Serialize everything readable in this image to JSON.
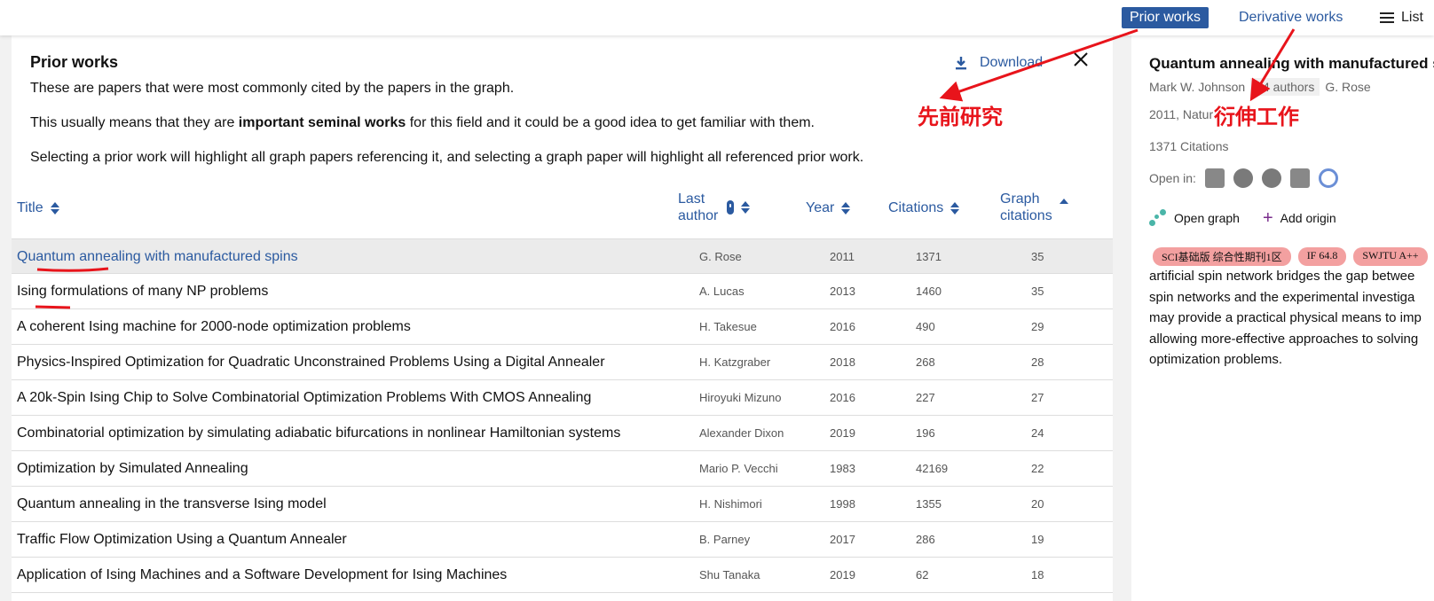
{
  "topbar": {
    "tabs": [
      {
        "label": "Prior works"
      },
      {
        "label": "Derivative works"
      },
      {
        "label": "List"
      }
    ]
  },
  "panel": {
    "title": "Prior works",
    "download_label": "Download",
    "intro_1": "These are papers that were most commonly cited by the papers in the graph.",
    "intro_2_pre": "This usually means that they are ",
    "intro_2_bold": "important seminal works",
    "intro_2_post": " for this field and it could be a good idea to get familiar with them.",
    "intro_3": "Selecting a prior work will highlight all graph papers referencing it, and selecting a graph paper will highlight all referenced prior work."
  },
  "table": {
    "headers": {
      "title": "Title",
      "last_author_1": "Last",
      "last_author_2": "author",
      "year": "Year",
      "citations": "Citations",
      "graph_citations_1": "Graph",
      "graph_citations_2": "citations"
    },
    "rows": [
      {
        "title": "Quantum annealing with manufactured spins",
        "author": "G. Rose",
        "year": "2011",
        "citations": "1371",
        "graph_citations": "35"
      },
      {
        "title": "Ising formulations of many NP problems",
        "author": "A. Lucas",
        "year": "2013",
        "citations": "1460",
        "graph_citations": "35"
      },
      {
        "title": "A coherent Ising machine for 2000-node optimization problems",
        "author": "H. Takesue",
        "year": "2016",
        "citations": "490",
        "graph_citations": "29"
      },
      {
        "title": "Physics-Inspired Optimization for Quadratic Unconstrained Problems Using a Digital Annealer",
        "author": "H. Katzgraber",
        "year": "2018",
        "citations": "268",
        "graph_citations": "28"
      },
      {
        "title": "A 20k-Spin Ising Chip to Solve Combinatorial Optimization Problems With CMOS Annealing",
        "author": "Hiroyuki Mizuno",
        "year": "2016",
        "citations": "227",
        "graph_citations": "27"
      },
      {
        "title": "Combinatorial optimization by simulating adiabatic bifurcations in nonlinear Hamiltonian systems",
        "author": "Alexander Dixon",
        "year": "2019",
        "citations": "196",
        "graph_citations": "24"
      },
      {
        "title": "Optimization by Simulated Annealing",
        "author": "Mario P. Vecchi",
        "year": "1983",
        "citations": "42169",
        "graph_citations": "22"
      },
      {
        "title": "Quantum annealing in the transverse Ising model",
        "author": "H. Nishimori",
        "year": "1998",
        "citations": "1355",
        "graph_citations": "20"
      },
      {
        "title": "Traffic Flow Optimization Using a Quantum Annealer",
        "author": "B. Parney",
        "year": "2017",
        "citations": "286",
        "graph_citations": "19"
      },
      {
        "title": "Application of Ising Machines and a Software Development for Ising Machines",
        "author": "Shu Tanaka",
        "year": "2019",
        "citations": "62",
        "graph_citations": "18"
      }
    ]
  },
  "side": {
    "title": "Quantum annealing with manufactured s",
    "first_author": "Mark W. Johnson",
    "authors_more": "24 authors",
    "last_author": "G. Rose",
    "meta": "2011, Natur",
    "citations": "1371 Citations",
    "open_in_label": "Open in:",
    "open_graph_label": "Open graph",
    "add_origin_label": "Add origin",
    "tags": [
      "SCI基础版 综合性期刊1区",
      "IF 64.8",
      "SWJTU A++"
    ],
    "abstract_lines": [
      "artificial spin network bridges the gap betwee",
      "spin networks and the experimental investiga",
      "may provide a practical physical means to imp",
      "allowing more-effective approaches to solving",
      "optimization problems."
    ]
  },
  "annotations": {
    "prior": "先前研究",
    "derivative": "衍伸工作"
  },
  "colors": {
    "accent": "#2b5aa0",
    "annotation": "#e8141b",
    "tag": "#f3a0a0"
  }
}
